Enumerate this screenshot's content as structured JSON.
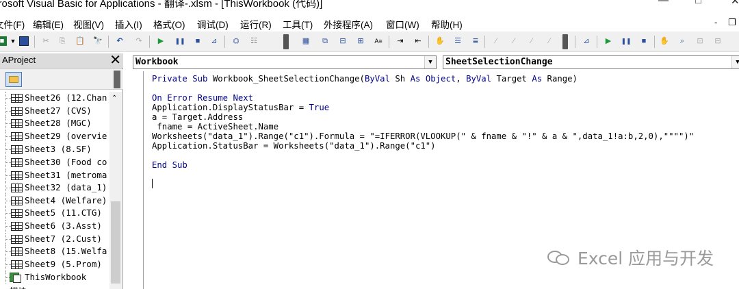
{
  "window": {
    "title": "crosoft Visual Basic for Applications - 翻译-.xlsm - [ThisWorkbook (代码)]",
    "minimize": "—",
    "maximize": "□",
    "close": "✕"
  },
  "menu": {
    "items": [
      "文件(F)",
      "编辑(E)",
      "视图(V)",
      "插入(I)",
      "格式(O)",
      "调试(D)",
      "运行(R)",
      "工具(T)",
      "外接程序(A)",
      "窗口(W)",
      "帮助(H)"
    ],
    "mdi_minimize": "-",
    "mdi_restore": "❐"
  },
  "toolbar": {
    "icons": [
      "excel-icon",
      "dropdown-arrow-icon",
      "save-icon",
      "cut-icon",
      "copy-icon",
      "paste-icon",
      "find-icon",
      "undo-icon",
      "redo-icon",
      "run-icon",
      "break-icon",
      "reset-icon",
      "design-mode-icon",
      "project-explorer-icon",
      "properties-icon",
      "object-browser-icon",
      "toolbox-icon",
      "tab-order-icon",
      "align-icon",
      "text-size-icon",
      "indent-icon",
      "outdent-icon",
      "breakpoint-icon",
      "comment-icon",
      "uncomment-icon",
      "bookmark-icon",
      "next-bookmark-icon",
      "prev-bookmark-icon",
      "clear-bookmarks-icon",
      "design-icon2",
      "run-icon2",
      "break-icon2",
      "reset-icon2",
      "toggle-breakpoint-icon",
      "quick-watch-icon",
      "call-stack-icon",
      "immediate-icon"
    ]
  },
  "project": {
    "title": "AProject",
    "close": "✕",
    "items": [
      {
        "label": "Sheet26 (12.Chan",
        "type": "sheet"
      },
      {
        "label": "Sheet27 (CVS)",
        "type": "sheet"
      },
      {
        "label": "Sheet28 (MGC)",
        "type": "sheet"
      },
      {
        "label": "Sheet29 (overvie",
        "type": "sheet"
      },
      {
        "label": "Sheet3 (8.SF)",
        "type": "sheet"
      },
      {
        "label": "Sheet30 (Food co",
        "type": "sheet"
      },
      {
        "label": "Sheet31 (metroma",
        "type": "sheet"
      },
      {
        "label": "Sheet32 (data_1)",
        "type": "sheet"
      },
      {
        "label": "Sheet4 (Welfare)",
        "type": "sheet"
      },
      {
        "label": "Sheet5 (11.CTG)",
        "type": "sheet"
      },
      {
        "label": "Sheet6 (3.Asst)",
        "type": "sheet"
      },
      {
        "label": "Sheet7 (2.Cust)",
        "type": "sheet"
      },
      {
        "label": "Sheet8 (15.Welfa",
        "type": "sheet"
      },
      {
        "label": "Sheet9 (5.Prom)",
        "type": "sheet"
      },
      {
        "label": "ThisWorkbook",
        "type": "workbook"
      },
      {
        "label": "模块",
        "type": "folder"
      }
    ]
  },
  "code_window": {
    "object_combo": "Workbook",
    "procedure_combo": "SheetSelectionChange",
    "lines": [
      [
        {
          "t": "Private Sub ",
          "k": 1
        },
        {
          "t": "Workbook_SheetSelectionChange(",
          "k": 0
        },
        {
          "t": "ByVal",
          "k": 1
        },
        {
          "t": " Sh ",
          "k": 0
        },
        {
          "t": "As",
          "k": 1
        },
        {
          "t": " ",
          "k": 0
        },
        {
          "t": "Object",
          "k": 1
        },
        {
          "t": ", ",
          "k": 0
        },
        {
          "t": "ByVal",
          "k": 1
        },
        {
          "t": " Target ",
          "k": 0
        },
        {
          "t": "As",
          "k": 1
        },
        {
          "t": " Range)",
          "k": 0
        }
      ],
      [
        {
          "t": "",
          "k": 0
        }
      ],
      [
        {
          "t": "On Error Resume Next",
          "k": 1
        }
      ],
      [
        {
          "t": "Application.DisplayStatusBar = ",
          "k": 0
        },
        {
          "t": "True",
          "k": 1
        }
      ],
      [
        {
          "t": "a = Target.Address",
          "k": 0
        }
      ],
      [
        {
          "t": " fname = ActiveSheet.Name",
          "k": 0
        }
      ],
      [
        {
          "t": "Worksheets(\"data_1\").Range(\"c1\").Formula = \"=IFERROR(VLOOKUP(\" & fname & \"!\" & a & \",data_1!a:b,2,0),\"\"\"\")\"",
          "k": 0
        }
      ],
      [
        {
          "t": "Application.StatusBar = Worksheets(\"data_1\").Range(\"c1\")",
          "k": 0
        }
      ],
      [
        {
          "t": "",
          "k": 0
        }
      ],
      [
        {
          "t": "End Sub",
          "k": 1
        }
      ]
    ]
  },
  "watermark": {
    "icon": "wechat-icon",
    "text": "Excel 应用与开发"
  },
  "colors": {
    "keyword": "#00008b",
    "toolbar_bg": "#f0f0f0"
  }
}
